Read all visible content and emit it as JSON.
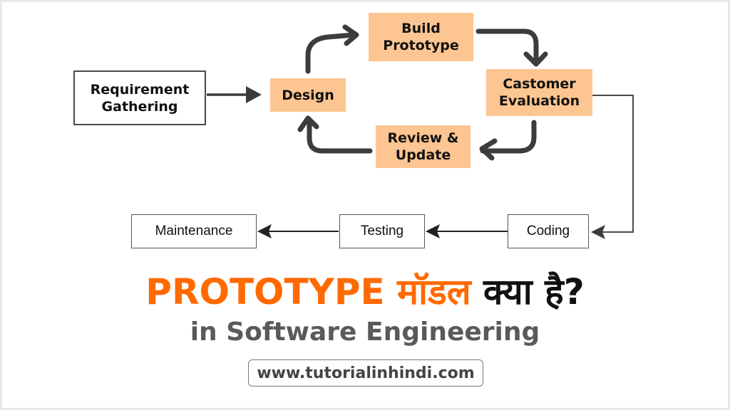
{
  "diagram": {
    "nodes": {
      "requirement_gathering": "Requirement\nGathering",
      "design": "Design",
      "build_prototype": "Build\nPrototype",
      "customer_evaluation": "Castomer\nEvaluation",
      "review_update": "Review &\nUpdate",
      "coding": "Coding",
      "testing": "Testing",
      "maintenance": "Maintenance"
    },
    "edges": [
      {
        "from": "Requirement Gathering",
        "to": "Design"
      },
      {
        "from": "Design",
        "to": "Build Prototype"
      },
      {
        "from": "Build Prototype",
        "to": "Castomer Evaluation"
      },
      {
        "from": "Castomer Evaluation",
        "to": "Review & Update"
      },
      {
        "from": "Review & Update",
        "to": "Design"
      },
      {
        "from": "Castomer Evaluation",
        "to": "Coding"
      },
      {
        "from": "Coding",
        "to": "Testing"
      },
      {
        "from": "Testing",
        "to": "Maintenance"
      }
    ],
    "colors": {
      "prototype_box": "#fdc591",
      "arrow": "#3c3c3c",
      "accent": "#ff6a00"
    }
  },
  "heading": {
    "english": "PROTOTYPE",
    "hindi_orange": "मॉडल",
    "hindi_black": "क्या है?"
  },
  "subheading": "in Software Engineering",
  "website": "www.tutorialinhindi.com"
}
